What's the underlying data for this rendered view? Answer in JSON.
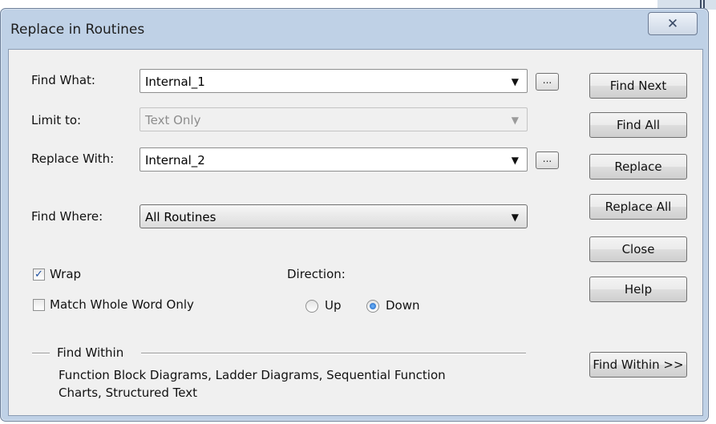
{
  "window": {
    "title": "Replace in Routines",
    "close_glyph": "✕"
  },
  "find_what": {
    "label": "Find What:",
    "value": "Internal_1",
    "ellipsis": "..."
  },
  "limit_to": {
    "label": "Limit to:",
    "value": "Text Only"
  },
  "replace_with": {
    "label": "Replace With:",
    "value": "Internal_2",
    "ellipsis": "..."
  },
  "find_where": {
    "label": "Find Where:",
    "value": "All Routines"
  },
  "options": {
    "wrap": {
      "label": "Wrap",
      "checked": true,
      "mark": "✓"
    },
    "match_whole_word": {
      "label": "Match Whole Word Only",
      "checked": false
    }
  },
  "direction": {
    "label": "Direction:",
    "up": {
      "label": "Up",
      "selected": false
    },
    "down": {
      "label": "Down",
      "selected": true
    }
  },
  "find_within": {
    "header": "Find Within",
    "text_line1": "Function Block Diagrams, Ladder Diagrams, Sequential Function",
    "text_line2": "Charts, Structured Text"
  },
  "buttons": {
    "find_next": "Find Next",
    "find_all": "Find All",
    "replace": "Replace",
    "replace_all": "Replace All",
    "close": "Close",
    "help": "Help",
    "find_within": "Find Within >>"
  },
  "glyphs": {
    "dropdown_arrow": "▼"
  }
}
